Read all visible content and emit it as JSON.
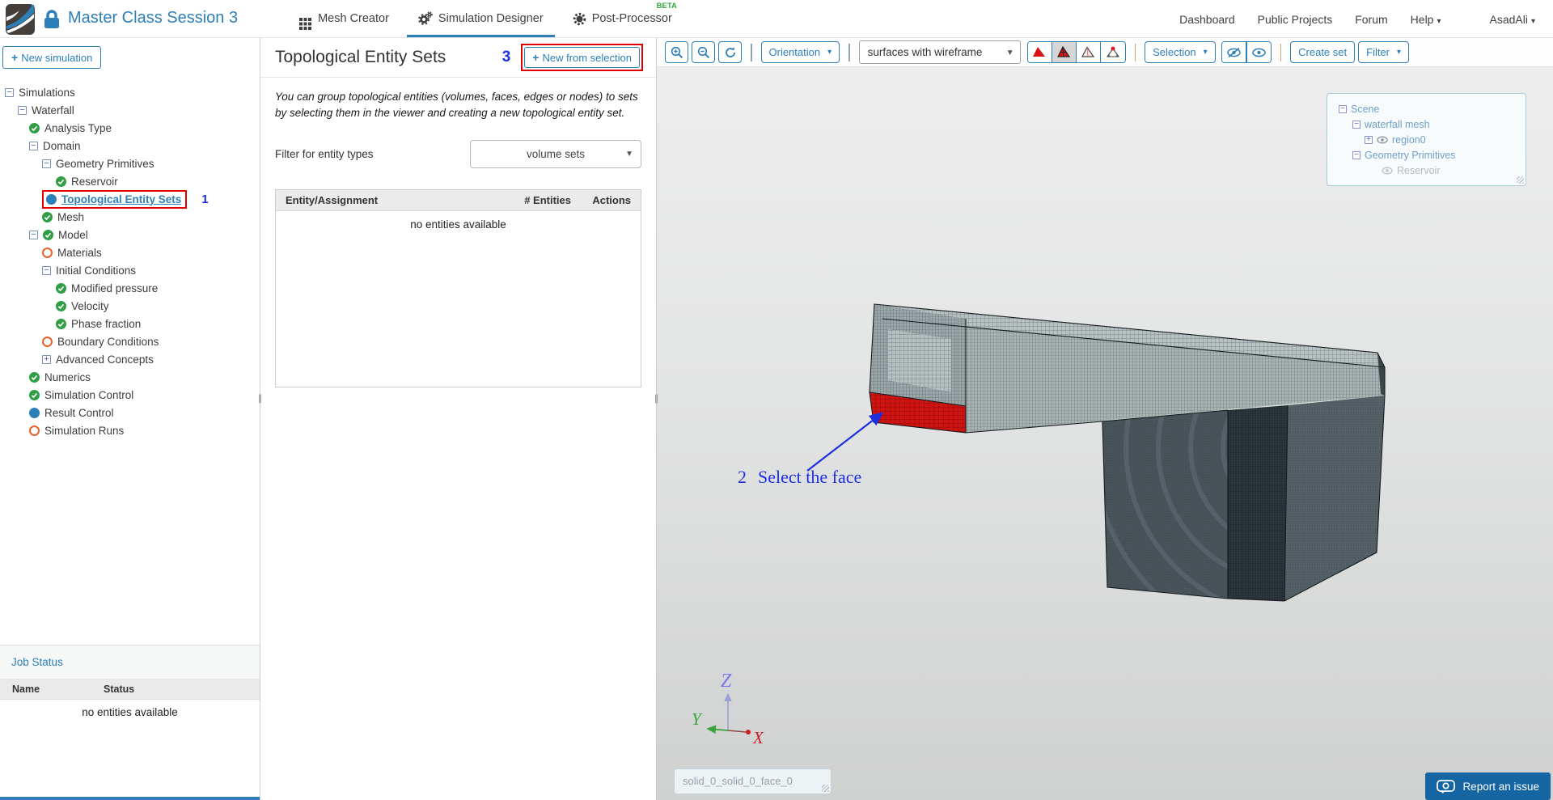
{
  "header": {
    "title": "Master Class Session 3",
    "tabs": [
      {
        "label": "Mesh Creator"
      },
      {
        "label": "Simulation Designer",
        "active": true
      },
      {
        "label": "Post-Processor",
        "badge": "BETA"
      }
    ],
    "nav_links": [
      "Dashboard",
      "Public Projects",
      "Forum"
    ],
    "help_label": "Help",
    "user": "AsadAli"
  },
  "sidebar": {
    "new_simulation_label": "New simulation",
    "tree": [
      {
        "label": "Simulations",
        "level": 0,
        "expander": "minus"
      },
      {
        "label": "Waterfall",
        "level": 1,
        "expander": "minus"
      },
      {
        "label": "Analysis Type",
        "level": 2,
        "status": "check"
      },
      {
        "label": "Domain",
        "level": 2,
        "expander": "minus"
      },
      {
        "label": "Geometry Primitives",
        "level": 3,
        "expander": "minus"
      },
      {
        "label": "Reservoir",
        "level": 4,
        "status": "check"
      },
      {
        "label": "Topological Entity Sets",
        "level": 3,
        "status": "dot",
        "selected": true,
        "annotation": "1"
      },
      {
        "label": "Mesh",
        "level": 3,
        "status": "check"
      },
      {
        "label": "Model",
        "level": 2,
        "expander": "minus",
        "status": "check"
      },
      {
        "label": "Materials",
        "level": 3,
        "status": "ring"
      },
      {
        "label": "Initial Conditions",
        "level": 3,
        "expander": "minus"
      },
      {
        "label": "Modified pressure",
        "level": 4,
        "status": "check"
      },
      {
        "label": "Velocity",
        "level": 4,
        "status": "check"
      },
      {
        "label": "Phase fraction",
        "level": 4,
        "status": "check"
      },
      {
        "label": "Boundary Conditions",
        "level": 3,
        "status": "ring"
      },
      {
        "label": "Advanced Concepts",
        "level": 3,
        "expander": "plus"
      },
      {
        "label": "Numerics",
        "level": 2,
        "status": "check"
      },
      {
        "label": "Simulation Control",
        "level": 2,
        "status": "check"
      },
      {
        "label": "Result Control",
        "level": 2,
        "status": "dot"
      },
      {
        "label": "Simulation Runs",
        "level": 2,
        "status": "ring"
      }
    ],
    "job_status": {
      "title": "Job Status",
      "columns": [
        "Name",
        "Status"
      ],
      "empty_text": "no entities available"
    }
  },
  "panel": {
    "title": "Topological Entity Sets",
    "annotation": "3",
    "new_button": "New from selection",
    "description": "You can group topological entities (volumes, faces, edges or nodes) to sets by selecting them in the viewer and creating a new topological entity set.",
    "filter_label": "Filter for entity types",
    "filter_value": "volume sets",
    "table": {
      "columns": [
        "Entity/Assignment",
        "# Entities",
        "Actions"
      ],
      "empty_text": "no entities available"
    }
  },
  "viewer": {
    "toolbar": {
      "orientation": "Orientation",
      "render_mode": "surfaces with wireframe",
      "selection": "Selection",
      "create_set": "Create set",
      "filter": "Filter"
    },
    "scene_tree": {
      "items": [
        {
          "label": "Scene",
          "pad": 6,
          "expander": "minus"
        },
        {
          "label": "waterfall mesh",
          "pad": 23,
          "expander": "minus"
        },
        {
          "label": "region0",
          "pad": 38,
          "expander": "plus",
          "eye": true
        },
        {
          "label": "Geometry Primitives",
          "pad": 23,
          "expander": "minus"
        },
        {
          "label": "Reservoir",
          "pad": 59,
          "eye": true,
          "dim": true
        }
      ]
    },
    "annotation": {
      "number": "2",
      "text": "Select the face"
    },
    "axis": {
      "x": "X",
      "y": "Y",
      "z": "Z"
    },
    "selection_name": "solid_0_solid_0_face_0",
    "report_button": "Report an issue"
  },
  "colors": {
    "accent_blue": "#2d7fb8",
    "annotation_blue": "#1d2fe0",
    "highlight_red": "#e10000",
    "selected_face_red": "#cf1311",
    "beta_green": "#2eaa3c",
    "check_green": "#2f9e44",
    "pending_orange": "#e8622d"
  }
}
